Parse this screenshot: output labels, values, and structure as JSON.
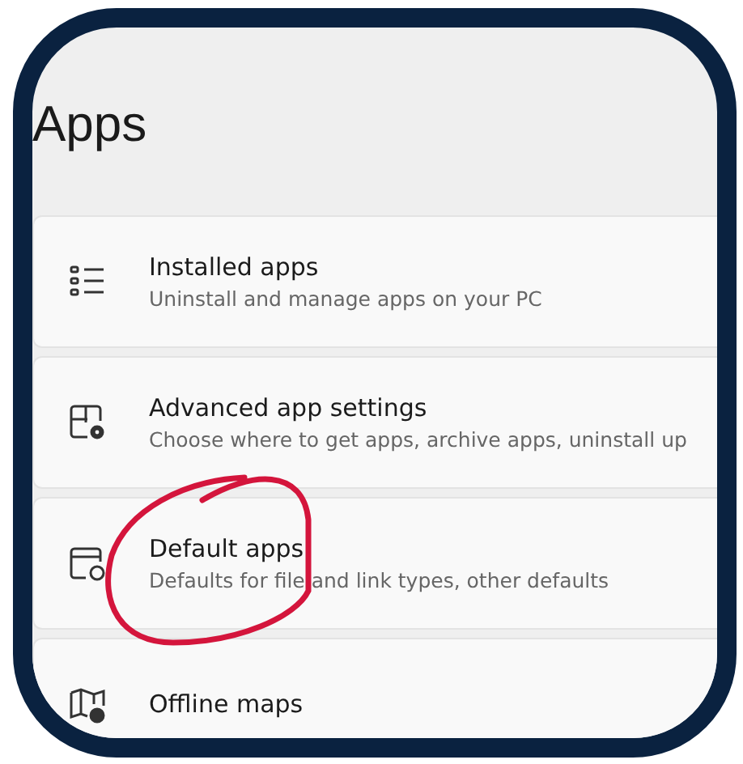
{
  "title": "Apps",
  "items": [
    {
      "kind": "list",
      "title": "Installed apps",
      "subtitle": "Uninstall and manage apps on your PC",
      "circled": false
    },
    {
      "kind": "window-gear",
      "title": "Advanced app settings",
      "subtitle": "Choose where to get apps, archive apps, uninstall up",
      "circled": false
    },
    {
      "kind": "window-badge",
      "title": "Default apps",
      "subtitle": "Defaults for file and link types, other defaults",
      "circled": true
    },
    {
      "kind": "map",
      "title": "Offline maps",
      "circled": false
    }
  ]
}
